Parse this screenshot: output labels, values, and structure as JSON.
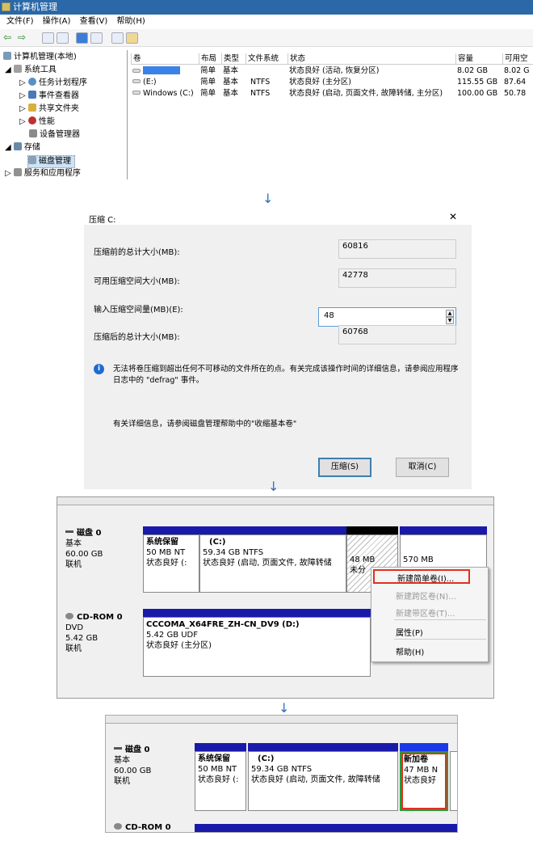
{
  "window": {
    "title": "计算机管理"
  },
  "menu": [
    "文件(F)",
    "操作(A)",
    "查看(V)",
    "帮助(H)"
  ],
  "tree": {
    "root": "计算机管理(本地)",
    "items": [
      "系统工具",
      "任务计划程序",
      "事件查看器",
      "共享文件夹",
      "性能",
      "设备管理器",
      "存储",
      "磁盘管理",
      "服务和应用程序"
    ]
  },
  "table": {
    "headers": [
      "卷",
      "布局",
      "类型",
      "文件系统",
      "状态",
      "容量",
      "可用空"
    ],
    "rows": [
      {
        "vol": "",
        "layout": "简单",
        "type": "基本",
        "fs": "",
        "status": "状态良好 (活动, 恢复分区)",
        "cap": "8.02 GB",
        "free": "8.02 G"
      },
      {
        "vol": "(E:)",
        "layout": "简单",
        "type": "基本",
        "fs": "NTFS",
        "status": "状态良好 (主分区)",
        "cap": "115.55 GB",
        "free": "87.64"
      },
      {
        "vol": "Windows (C:)",
        "layout": "简单",
        "type": "基本",
        "fs": "NTFS",
        "status": "状态良好 (启动, 页面文件, 故障转储, 主分区)",
        "cap": "100.00 GB",
        "free": "50.78"
      }
    ]
  },
  "arrows": [
    "↓",
    "↓",
    "↓"
  ],
  "shrink": {
    "title": "压缩 C:",
    "close": "✕",
    "label_total": "压缩前的总计大小(MB):",
    "val_total": "60816",
    "label_avail": "可用压缩空间大小(MB):",
    "val_avail": "42778",
    "label_input": "输入压缩空间量(MB)(E):",
    "val_input": "48",
    "label_after": "压缩后的总计大小(MB):",
    "val_after": "60768",
    "info": "无法将卷压缩到超出任何不可移动的文件所在的点。有关完成该操作时间的详细信息，请参阅应用程序日志中的 \"defrag\" 事件。",
    "help": "有关详细信息，请参阅磁盘管理帮助中的\"收缩基本卷\"",
    "btn_shrink": "压缩(S)",
    "btn_cancel": "取消(C)"
  },
  "disk0": {
    "name": "磁盘 0",
    "type": "基本",
    "size": "60.00 GB",
    "status": "联机",
    "p_sys": {
      "name": "系统保留",
      "size": "50 MB NT",
      "status": "状态良好 (:"
    },
    "p_c": {
      "name": "(C:)",
      "size": "59.34 GB NTFS",
      "status": "状态良好 (启动, 页面文件, 故障转储"
    },
    "p_unalloc": {
      "size": "48 MB",
      "label": "未分"
    },
    "p_570": {
      "size": "570 MB"
    }
  },
  "cdrom": {
    "name": "CD-ROM 0",
    "type": "DVD",
    "size": "5.42 GB",
    "status": "联机",
    "vol": "CCCOMA_X64FRE_ZH-CN_DV9  (D:)",
    "fs": "5.42 GB UDF",
    "vstatus": "状态良好 (主分区)"
  },
  "context_menu": [
    "新建简单卷(I)...",
    "新建跨区卷(N)...",
    "新建带区卷(T)...",
    "属性(P)",
    "帮助(H)"
  ],
  "result": {
    "disk": "磁盘 0",
    "type": "基本",
    "size": "60.00 GB",
    "status": "联机",
    "p_sys": {
      "name": "系统保留",
      "size": "50 MB NT",
      "status": "状态良好 (:"
    },
    "p_c": {
      "name": "(C:)",
      "size": "59.34 GB NTFS",
      "status": "状态良好 (启动, 页面文件, 故障转储"
    },
    "p_new": {
      "name": "新加卷",
      "size": "47 MB N",
      "status": "状态良好"
    },
    "cdrom": "CD-ROM 0"
  }
}
